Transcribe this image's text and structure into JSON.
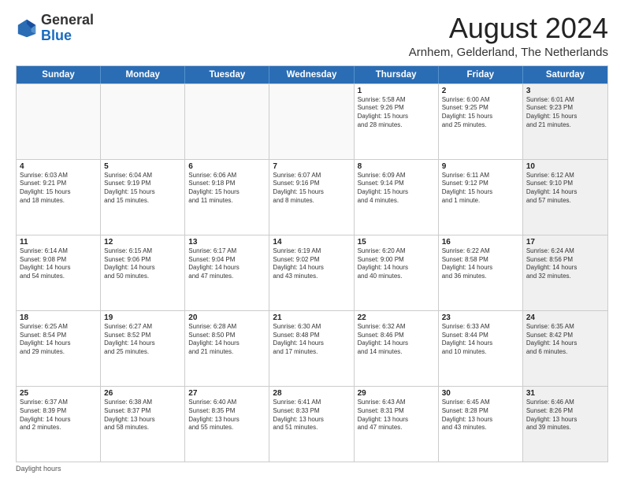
{
  "header": {
    "logo_general": "General",
    "logo_blue": "Blue",
    "month_title": "August 2024",
    "location": "Arnhem, Gelderland, The Netherlands"
  },
  "calendar": {
    "days_of_week": [
      "Sunday",
      "Monday",
      "Tuesday",
      "Wednesday",
      "Thursday",
      "Friday",
      "Saturday"
    ],
    "weeks": [
      [
        {
          "day": "",
          "info": "",
          "empty": true
        },
        {
          "day": "",
          "info": "",
          "empty": true
        },
        {
          "day": "",
          "info": "",
          "empty": true
        },
        {
          "day": "",
          "info": "",
          "empty": true
        },
        {
          "day": "1",
          "info": "Sunrise: 5:58 AM\nSunset: 9:26 PM\nDaylight: 15 hours\nand 28 minutes."
        },
        {
          "day": "2",
          "info": "Sunrise: 6:00 AM\nSunset: 9:25 PM\nDaylight: 15 hours\nand 25 minutes."
        },
        {
          "day": "3",
          "info": "Sunrise: 6:01 AM\nSunset: 9:23 PM\nDaylight: 15 hours\nand 21 minutes.",
          "shaded": true
        }
      ],
      [
        {
          "day": "4",
          "info": "Sunrise: 6:03 AM\nSunset: 9:21 PM\nDaylight: 15 hours\nand 18 minutes."
        },
        {
          "day": "5",
          "info": "Sunrise: 6:04 AM\nSunset: 9:19 PM\nDaylight: 15 hours\nand 15 minutes."
        },
        {
          "day": "6",
          "info": "Sunrise: 6:06 AM\nSunset: 9:18 PM\nDaylight: 15 hours\nand 11 minutes."
        },
        {
          "day": "7",
          "info": "Sunrise: 6:07 AM\nSunset: 9:16 PM\nDaylight: 15 hours\nand 8 minutes."
        },
        {
          "day": "8",
          "info": "Sunrise: 6:09 AM\nSunset: 9:14 PM\nDaylight: 15 hours\nand 4 minutes."
        },
        {
          "day": "9",
          "info": "Sunrise: 6:11 AM\nSunset: 9:12 PM\nDaylight: 15 hours\nand 1 minute."
        },
        {
          "day": "10",
          "info": "Sunrise: 6:12 AM\nSunset: 9:10 PM\nDaylight: 14 hours\nand 57 minutes.",
          "shaded": true
        }
      ],
      [
        {
          "day": "11",
          "info": "Sunrise: 6:14 AM\nSunset: 9:08 PM\nDaylight: 14 hours\nand 54 minutes."
        },
        {
          "day": "12",
          "info": "Sunrise: 6:15 AM\nSunset: 9:06 PM\nDaylight: 14 hours\nand 50 minutes."
        },
        {
          "day": "13",
          "info": "Sunrise: 6:17 AM\nSunset: 9:04 PM\nDaylight: 14 hours\nand 47 minutes."
        },
        {
          "day": "14",
          "info": "Sunrise: 6:19 AM\nSunset: 9:02 PM\nDaylight: 14 hours\nand 43 minutes."
        },
        {
          "day": "15",
          "info": "Sunrise: 6:20 AM\nSunset: 9:00 PM\nDaylight: 14 hours\nand 40 minutes."
        },
        {
          "day": "16",
          "info": "Sunrise: 6:22 AM\nSunset: 8:58 PM\nDaylight: 14 hours\nand 36 minutes."
        },
        {
          "day": "17",
          "info": "Sunrise: 6:24 AM\nSunset: 8:56 PM\nDaylight: 14 hours\nand 32 minutes.",
          "shaded": true
        }
      ],
      [
        {
          "day": "18",
          "info": "Sunrise: 6:25 AM\nSunset: 8:54 PM\nDaylight: 14 hours\nand 29 minutes."
        },
        {
          "day": "19",
          "info": "Sunrise: 6:27 AM\nSunset: 8:52 PM\nDaylight: 14 hours\nand 25 minutes."
        },
        {
          "day": "20",
          "info": "Sunrise: 6:28 AM\nSunset: 8:50 PM\nDaylight: 14 hours\nand 21 minutes."
        },
        {
          "day": "21",
          "info": "Sunrise: 6:30 AM\nSunset: 8:48 PM\nDaylight: 14 hours\nand 17 minutes."
        },
        {
          "day": "22",
          "info": "Sunrise: 6:32 AM\nSunset: 8:46 PM\nDaylight: 14 hours\nand 14 minutes."
        },
        {
          "day": "23",
          "info": "Sunrise: 6:33 AM\nSunset: 8:44 PM\nDaylight: 14 hours\nand 10 minutes."
        },
        {
          "day": "24",
          "info": "Sunrise: 6:35 AM\nSunset: 8:42 PM\nDaylight: 14 hours\nand 6 minutes.",
          "shaded": true
        }
      ],
      [
        {
          "day": "25",
          "info": "Sunrise: 6:37 AM\nSunset: 8:39 PM\nDaylight: 14 hours\nand 2 minutes."
        },
        {
          "day": "26",
          "info": "Sunrise: 6:38 AM\nSunset: 8:37 PM\nDaylight: 13 hours\nand 58 minutes."
        },
        {
          "day": "27",
          "info": "Sunrise: 6:40 AM\nSunset: 8:35 PM\nDaylight: 13 hours\nand 55 minutes."
        },
        {
          "day": "28",
          "info": "Sunrise: 6:41 AM\nSunset: 8:33 PM\nDaylight: 13 hours\nand 51 minutes."
        },
        {
          "day": "29",
          "info": "Sunrise: 6:43 AM\nSunset: 8:31 PM\nDaylight: 13 hours\nand 47 minutes."
        },
        {
          "day": "30",
          "info": "Sunrise: 6:45 AM\nSunset: 8:28 PM\nDaylight: 13 hours\nand 43 minutes."
        },
        {
          "day": "31",
          "info": "Sunrise: 6:46 AM\nSunset: 8:26 PM\nDaylight: 13 hours\nand 39 minutes.",
          "shaded": true
        }
      ]
    ],
    "footer": "Daylight hours"
  }
}
